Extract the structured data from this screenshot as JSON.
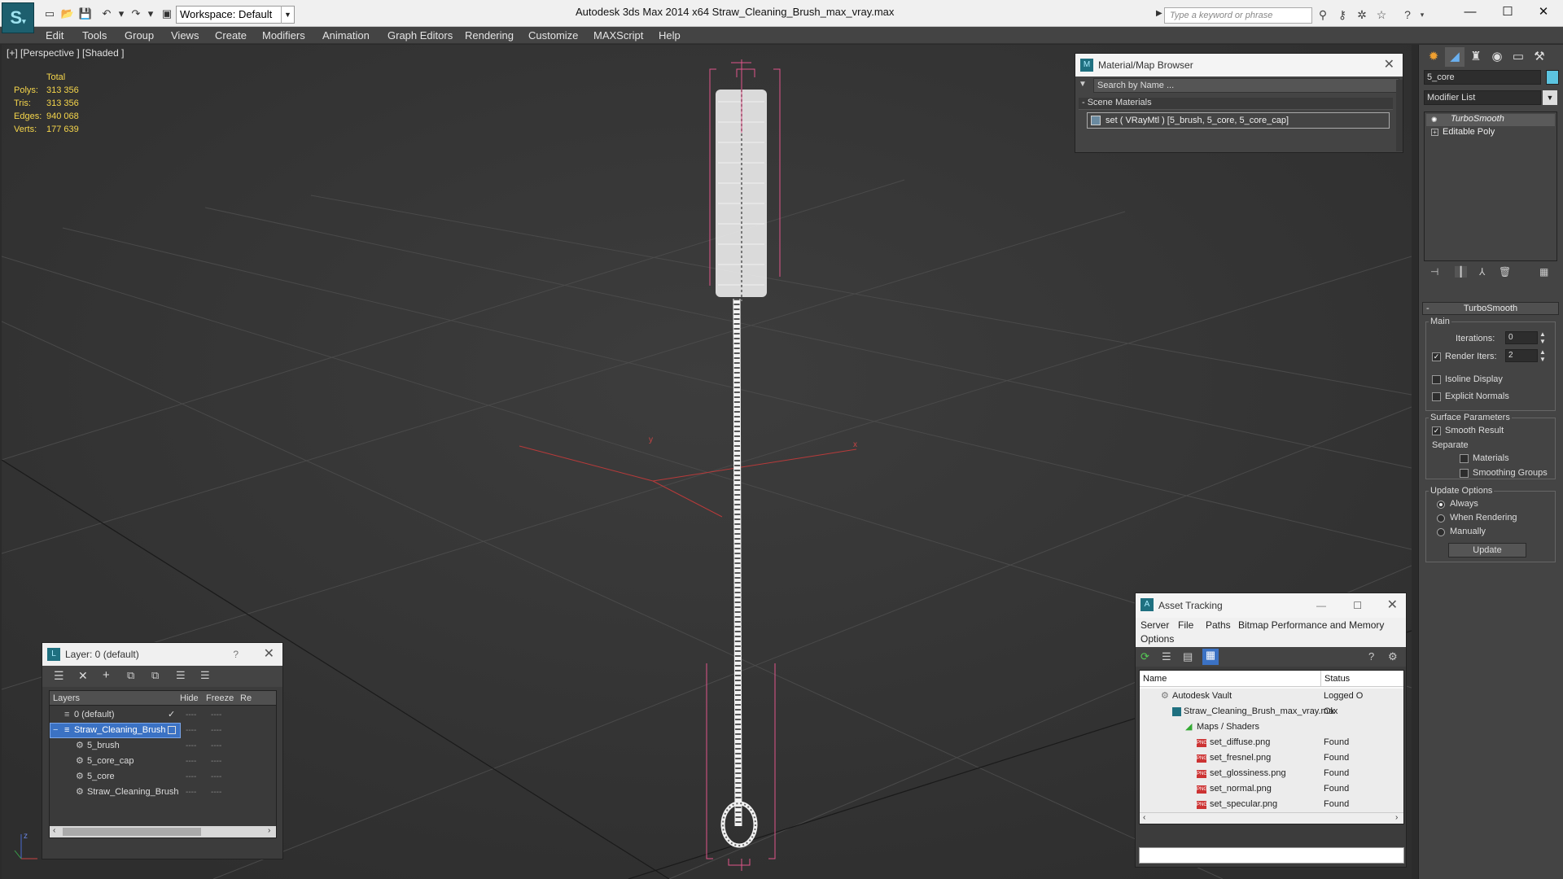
{
  "app": {
    "title": "Autodesk 3ds Max  2014 x64     Straw_Cleaning_Brush_max_vray.max",
    "logo": "3ds Max logo",
    "workspace": "Workspace: Default",
    "search_placeholder": "Type a keyword or phrase"
  },
  "menu": [
    "Edit",
    "Tools",
    "Group",
    "Views",
    "Create",
    "Modifiers",
    "Animation",
    "Graph Editors",
    "Rendering",
    "Customize",
    "MAXScript",
    "Help"
  ],
  "viewport": {
    "label": "[+] [Perspective ] [Shaded ]",
    "stats": {
      "header": "Total",
      "rows": [
        {
          "label": "Polys:",
          "value": "313 356"
        },
        {
          "label": "Tris:",
          "value": "313 356"
        },
        {
          "label": "Edges:",
          "value": "940 068"
        },
        {
          "label": "Verts:",
          "value": "177 639"
        }
      ]
    },
    "axes": {
      "y": "y",
      "x": "x",
      "z": "z"
    }
  },
  "material_browser": {
    "title": "Material/Map Browser",
    "search_placeholder": "Search by Name ...",
    "section": "- Scene Materials",
    "item": "set  ( VRayMtl ) [5_brush, 5_core, 5_core_cap]"
  },
  "layer_panel": {
    "title": "Layer: 0 (default)",
    "help": "?",
    "columns": [
      "Layers",
      "Hide",
      "Freeze",
      "Re"
    ],
    "rows": [
      {
        "name": "0 (default)",
        "indent": 0,
        "selected": false,
        "active": true
      },
      {
        "name": "Straw_Cleaning_Brush",
        "indent": 0,
        "selected": true,
        "active": false
      },
      {
        "name": "5_brush",
        "indent": 1,
        "selected": false,
        "active": false
      },
      {
        "name": "5_core_cap",
        "indent": 1,
        "selected": false,
        "active": false
      },
      {
        "name": "5_core",
        "indent": 1,
        "selected": false,
        "active": false
      },
      {
        "name": "Straw_Cleaning_Brush",
        "indent": 1,
        "selected": false,
        "active": false
      }
    ]
  },
  "asset_tracking": {
    "title": "Asset Tracking",
    "menu": [
      "Server",
      "File",
      "Paths",
      "Bitmap Performance and Memory",
      "Options"
    ],
    "columns": [
      "Name",
      "Status"
    ],
    "rows": [
      {
        "name": "Autodesk Vault",
        "status": "Logged O",
        "indent": 0,
        "icon": "vault-icon"
      },
      {
        "name": "Straw_Cleaning_Brush_max_vray.max",
        "status": "Ok",
        "indent": 1,
        "icon": "max-file-icon"
      },
      {
        "name": "Maps / Shaders",
        "status": "",
        "indent": 2,
        "icon": "maps-folder-icon"
      },
      {
        "name": "set_diffuse.png",
        "status": "Found",
        "indent": 3,
        "icon": "png-icon"
      },
      {
        "name": "set_fresnel.png",
        "status": "Found",
        "indent": 3,
        "icon": "png-icon"
      },
      {
        "name": "set_glossiness.png",
        "status": "Found",
        "indent": 3,
        "icon": "png-icon"
      },
      {
        "name": "set_normal.png",
        "status": "Found",
        "indent": 3,
        "icon": "png-icon"
      },
      {
        "name": "set_specular.png",
        "status": "Found",
        "indent": 3,
        "icon": "png-icon"
      }
    ]
  },
  "command_panel": {
    "object_name": "5_core",
    "modifier_list": "Modifier List",
    "stack": [
      "TurboSmooth",
      "Editable Poly"
    ],
    "turbosmooth": {
      "title": "TurboSmooth",
      "main": "Main",
      "iterations_label": "Iterations:",
      "iterations": "0",
      "render_iters_label": "Render Iters:",
      "render_iters": "2",
      "render_iters_checked": true,
      "isoline": "Isoline Display",
      "explicit": "Explicit Normals",
      "surface": "Surface Parameters",
      "smooth_result": "Smooth Result",
      "separate": "Separate",
      "materials": "Materials",
      "smoothing_groups": "Smoothing Groups",
      "update_options": "Update Options",
      "always": "Always",
      "when_rendering": "When Rendering",
      "manually": "Manually",
      "update_button": "Update"
    }
  },
  "colors": {
    "accent": "#5b8fd6",
    "stat_yellow": "#f6d64b",
    "selection_red": "#e0558a"
  }
}
